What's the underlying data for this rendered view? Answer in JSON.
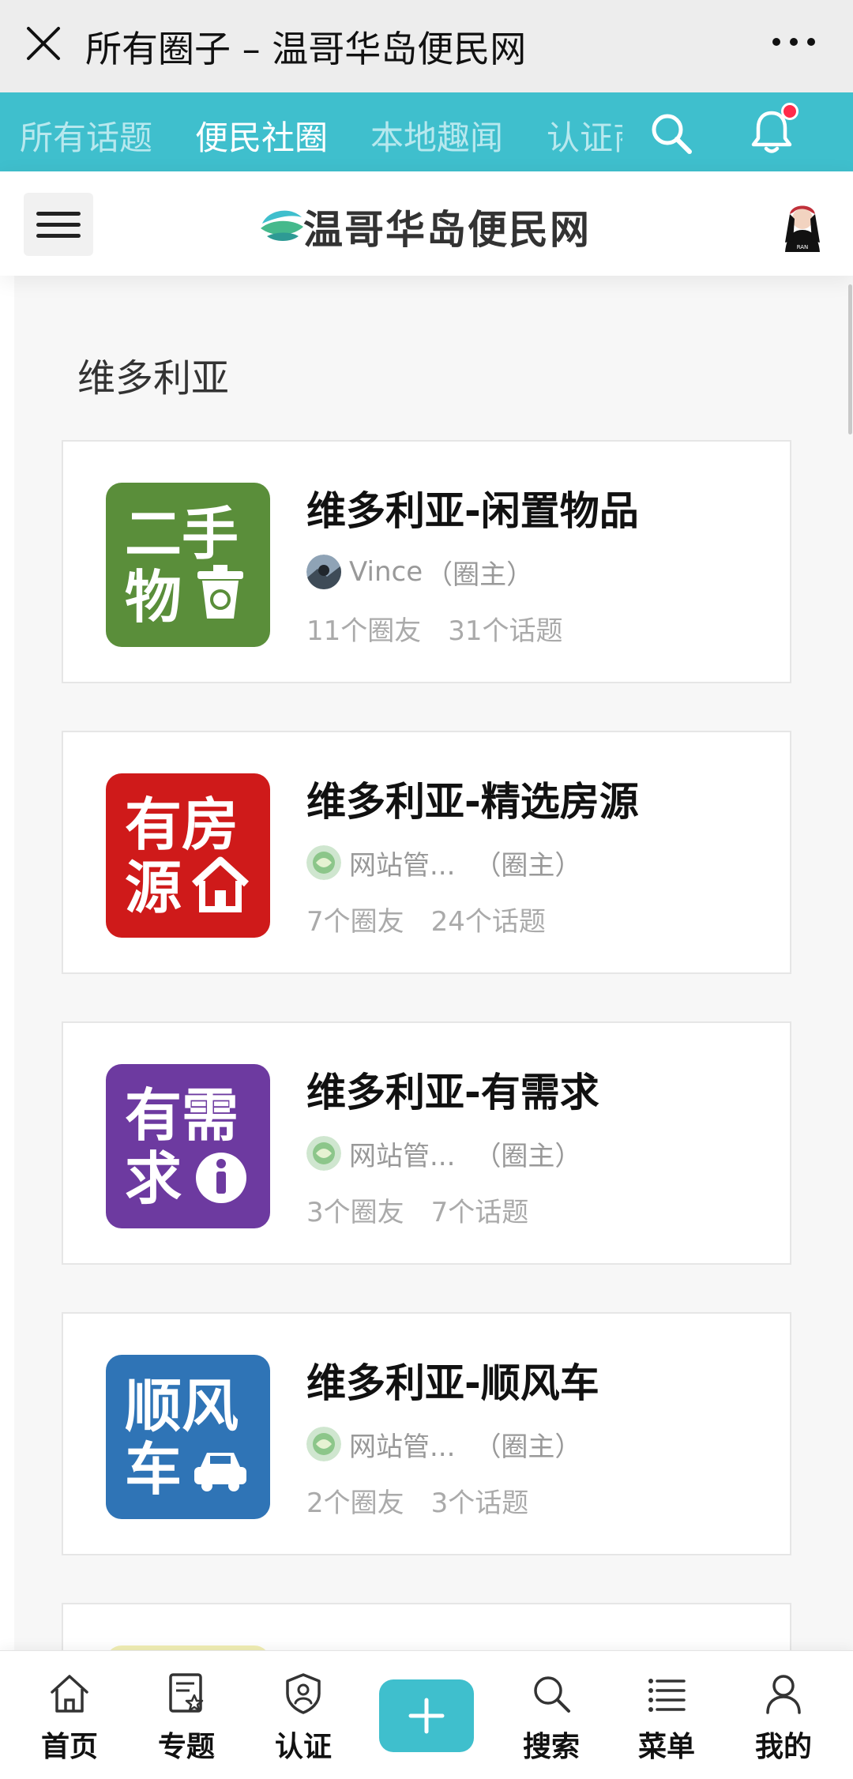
{
  "window": {
    "title": "所有圈子 – 温哥华岛便民网"
  },
  "tabs": [
    {
      "label": "所有话题",
      "active": false
    },
    {
      "label": "便民社圈",
      "active": true
    },
    {
      "label": "本地趣闻",
      "active": false
    },
    {
      "label": "认证商家",
      "active": false
    }
  ],
  "header": {
    "logo_text": "温哥华岛便民网",
    "avatar_text": "RAN"
  },
  "section": {
    "title": "维多利亚"
  },
  "circles": [
    {
      "title": "维多利亚-闲置物品",
      "icon_text": [
        "二手",
        "物"
      ],
      "icon_color": "#5a8e3a",
      "icon_symbol": "recycle-bin-icon",
      "owner": "Vince",
      "role": "（圈主）",
      "members": "11个圈友",
      "topics": "31个话题"
    },
    {
      "title": "维多利亚-精选房源",
      "icon_text": [
        "有房",
        "源"
      ],
      "icon_color": "#cf1a1a",
      "icon_symbol": "house-icon",
      "owner": "网站管...",
      "role": "（圈主）",
      "members": "7个圈友",
      "topics": "24个话题"
    },
    {
      "title": "维多利亚-有需求",
      "icon_text": [
        "有需",
        "求"
      ],
      "icon_color": "#6d3aa0",
      "icon_symbol": "info-icon",
      "owner": "网站管...",
      "role": "（圈主）",
      "members": "3个圈友",
      "topics": "7个话题"
    },
    {
      "title": "维多利亚-顺风车",
      "icon_text": [
        "顺风",
        "车"
      ],
      "icon_color": "#2f74b6",
      "icon_symbol": "car-icon",
      "owner": "网站管...",
      "role": "（圈主）",
      "members": "2个圈友",
      "topics": "3个话题"
    }
  ],
  "bottom_nav": [
    {
      "label": "首页",
      "icon": "home-icon"
    },
    {
      "label": "专题",
      "icon": "topic-icon"
    },
    {
      "label": "认证",
      "icon": "verify-icon"
    },
    {
      "label": "",
      "icon": "plus-icon"
    },
    {
      "label": "搜索",
      "icon": "search-icon"
    },
    {
      "label": "菜单",
      "icon": "menu-icon"
    },
    {
      "label": "我的",
      "icon": "user-icon"
    }
  ],
  "colors": {
    "accent": "#3fbfcd",
    "notification": "#ff2b4a"
  }
}
